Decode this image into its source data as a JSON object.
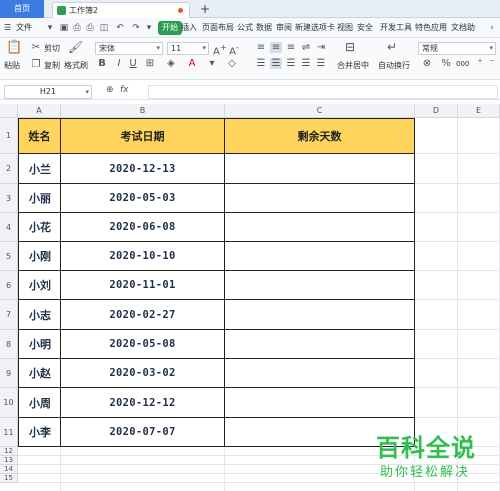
{
  "tabs": {
    "home": "首页",
    "doc": "工作簿2",
    "add": "+"
  },
  "menubar": {
    "file": "文件",
    "items": [
      "开始",
      "插入",
      "页面布局",
      "公式",
      "数据",
      "审阅",
      "新建选项卡",
      "视图",
      "安全",
      "开发工具",
      "特色应用",
      "文档助"
    ]
  },
  "ribbon": {
    "paste": "粘贴",
    "cut": "剪切",
    "copy": "复制",
    "format_painter": "格式刷",
    "font_name": "宋体",
    "font_size": "11",
    "bold": "B",
    "italic": "I",
    "underline": "U",
    "merge_center": "合并居中",
    "wrap_text": "自动换行",
    "number_format": "常规",
    "percent": "%",
    "thousands": "000"
  },
  "formula_bar": {
    "name_box": "H21",
    "fx": "fx",
    "value": ""
  },
  "columns": [
    "A",
    "B",
    "C",
    "D",
    "E"
  ],
  "rows": [
    "1",
    "2",
    "3",
    "4",
    "5",
    "6",
    "7",
    "8",
    "9",
    "10",
    "11",
    "12",
    "13",
    "14",
    "15"
  ],
  "table": {
    "headers": [
      "姓名",
      "考试日期",
      "剩余天数"
    ],
    "rows": [
      {
        "name": "小兰",
        "date": "2020-12-13",
        "remain": ""
      },
      {
        "name": "小丽",
        "date": "2020-05-03",
        "remain": ""
      },
      {
        "name": "小花",
        "date": "2020-06-08",
        "remain": ""
      },
      {
        "name": "小刚",
        "date": "2020-10-10",
        "remain": ""
      },
      {
        "name": "小刘",
        "date": "2020-11-01",
        "remain": ""
      },
      {
        "name": "小志",
        "date": "2020-02-27",
        "remain": ""
      },
      {
        "name": "小明",
        "date": "2020-05-08",
        "remain": ""
      },
      {
        "name": "小赵",
        "date": "2020-03-02",
        "remain": ""
      },
      {
        "name": "小周",
        "date": "2020-12-12",
        "remain": ""
      },
      {
        "name": "小李",
        "date": "2020-07-07",
        "remain": ""
      }
    ]
  },
  "watermark": {
    "title": "百科全说",
    "subtitle": "助你轻松解决"
  },
  "colors": {
    "header_fill": "#ffd45c",
    "accent": "#2c9c4f",
    "tab_blue": "#3c7be0"
  }
}
